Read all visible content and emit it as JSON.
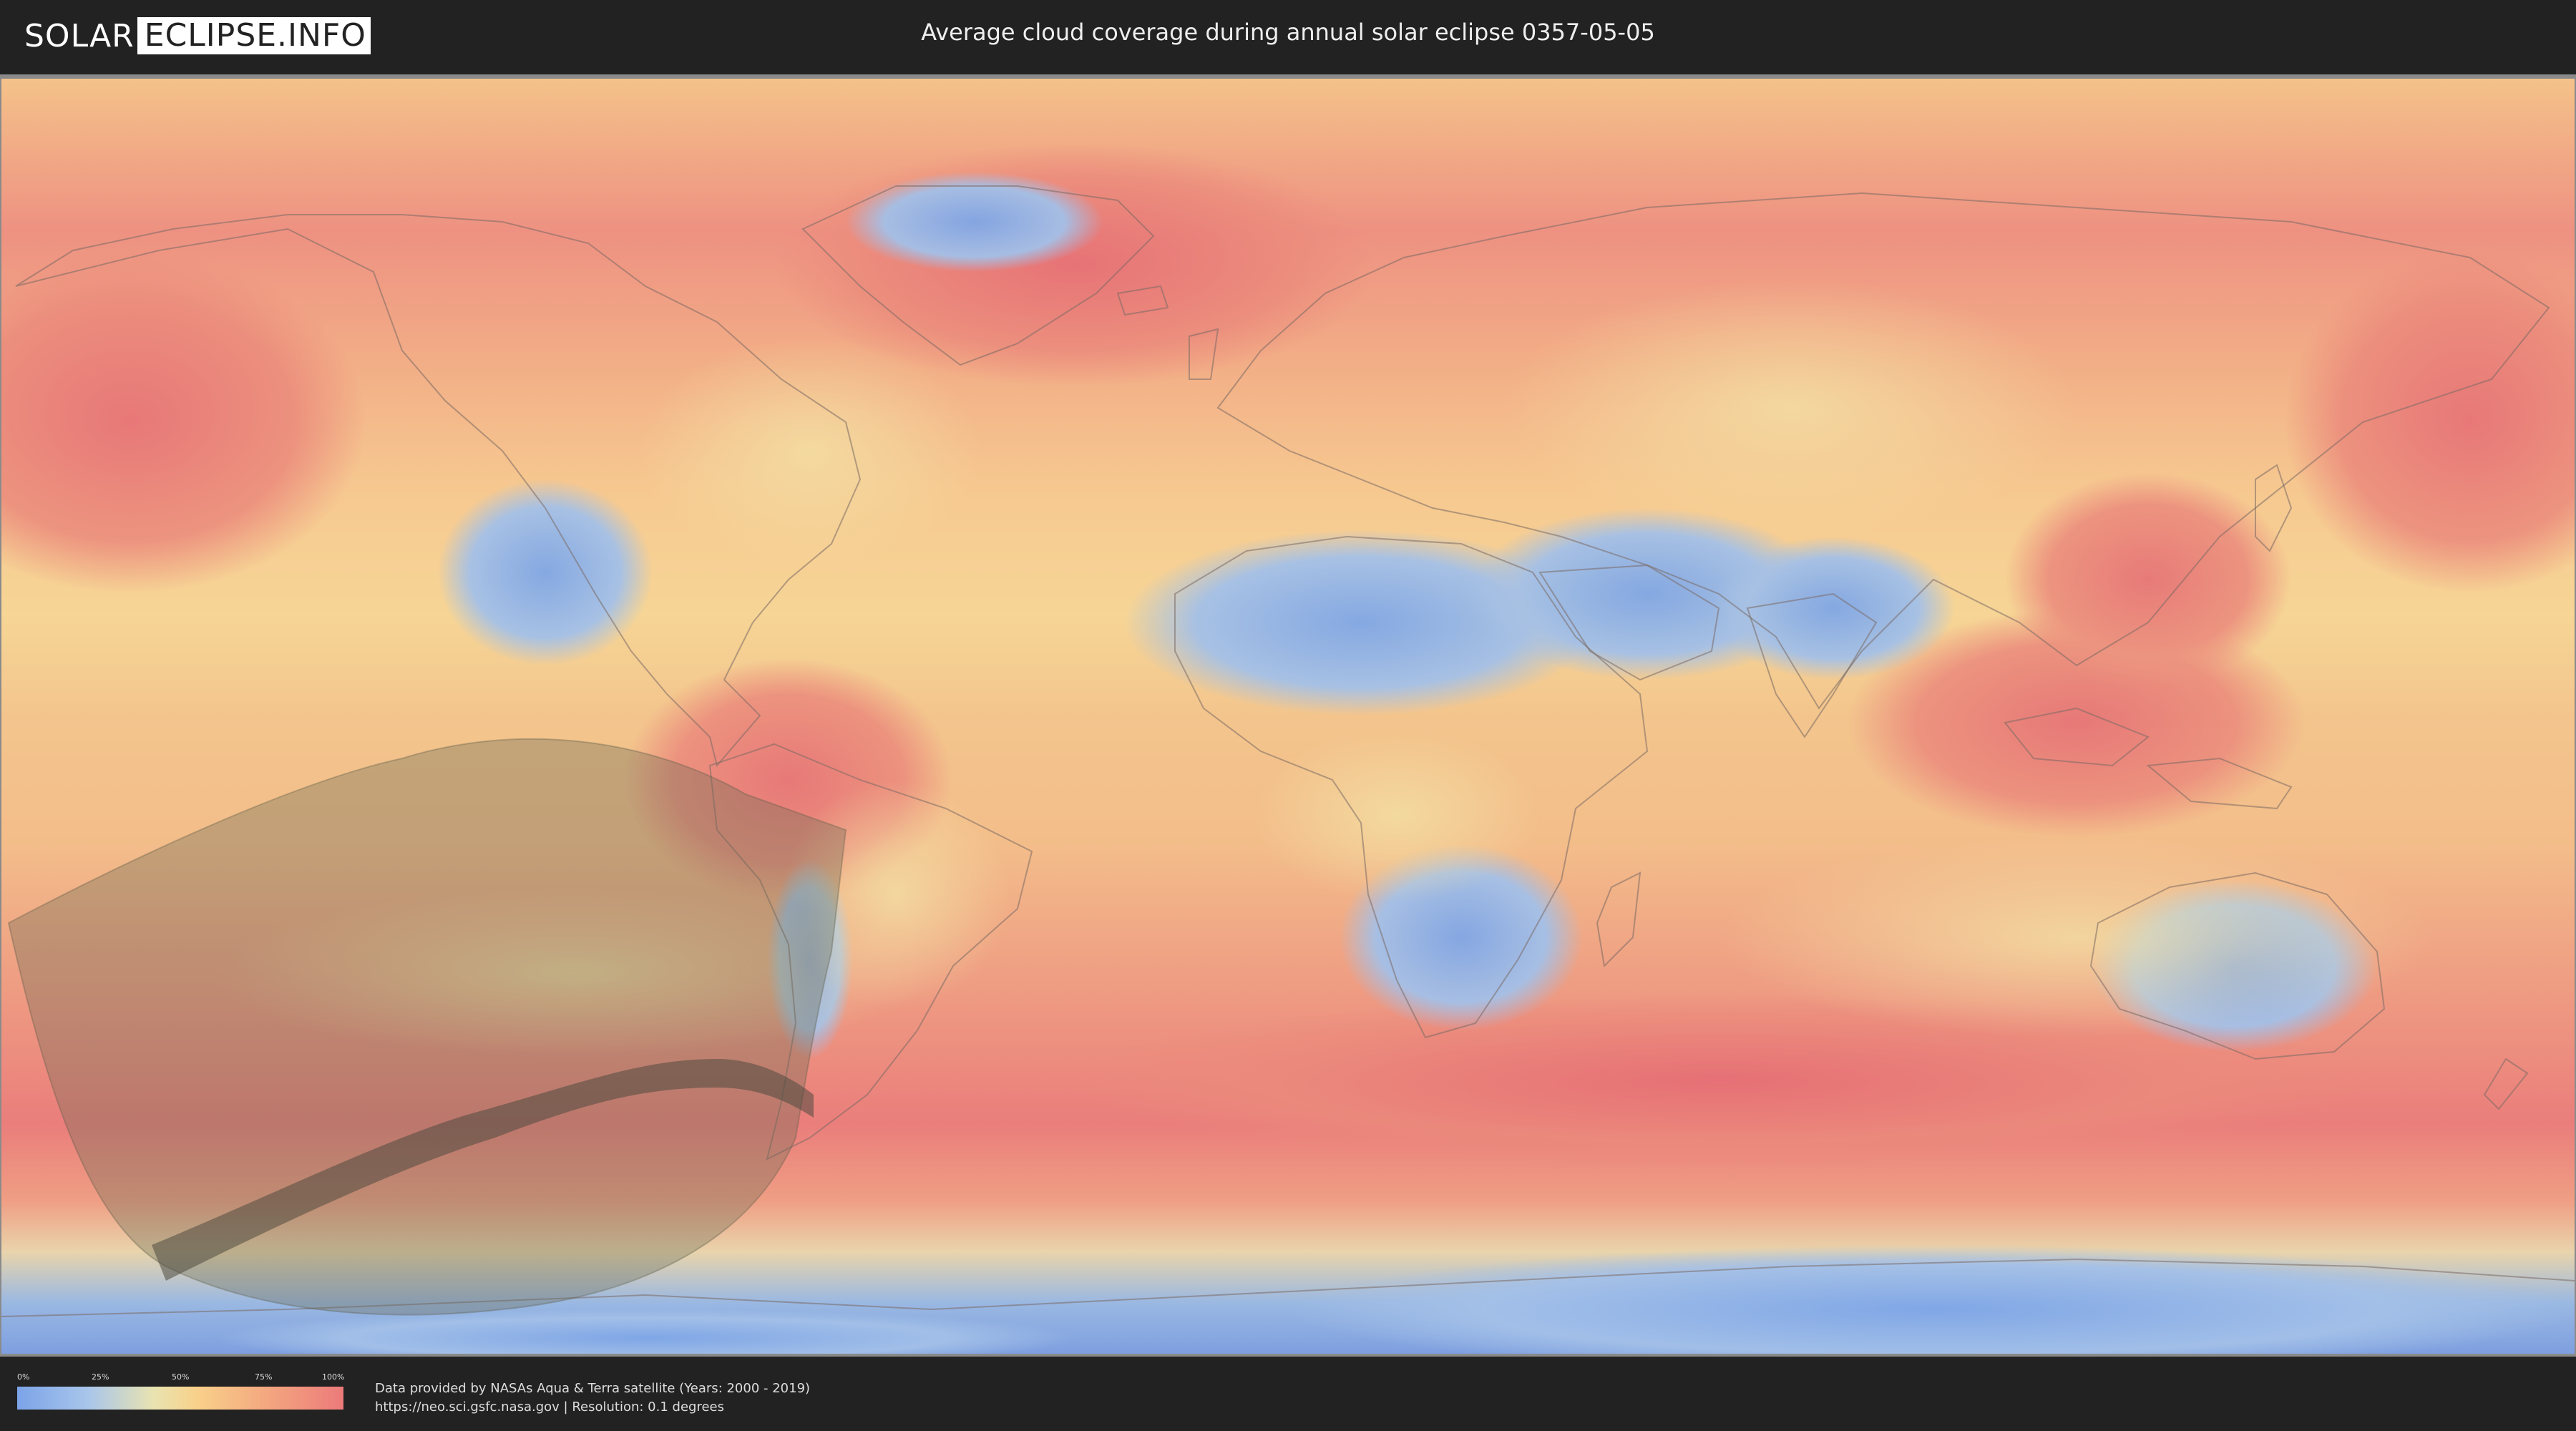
{
  "header": {
    "logo_left": "SOLAR",
    "logo_right": "ECLIPSE.INFO",
    "title": "Average cloud coverage during annual solar eclipse 0357-05-05"
  },
  "legend": {
    "ticks": [
      "0%",
      "25%",
      "50%",
      "75%",
      "100%"
    ],
    "colors": [
      "#7ba3e8",
      "#e9e3b0",
      "#f8d18b",
      "#ec7a7a"
    ]
  },
  "footer": {
    "credit_line1": "Data provided by NASAs Aqua & Terra satellite (Years: 2000 - 2019)",
    "credit_line2": "https://neo.sci.gsfc.nasa.gov | Resolution: 0.1 degrees"
  },
  "map": {
    "ocean_color": "#f3b182",
    "clear_color": "#8fb4e8",
    "cloudy_color": "#ea7a78",
    "moderate_color": "#f6cf8e"
  }
}
